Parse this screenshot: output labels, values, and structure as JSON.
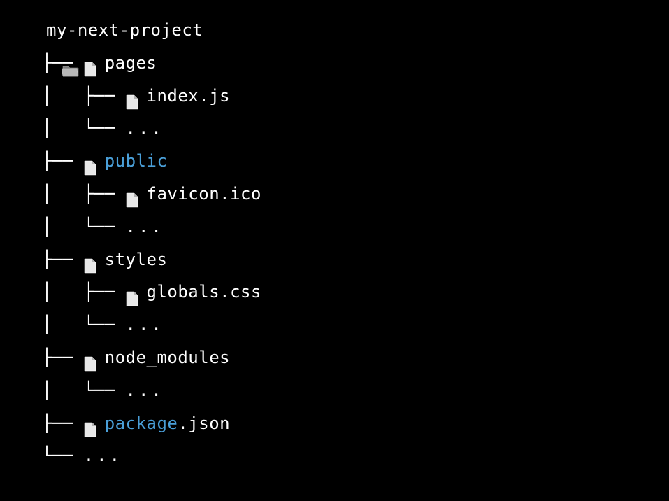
{
  "tree": {
    "root": {
      "name": "my-next-project",
      "type": "folder"
    },
    "lines": [
      {
        "prefix": "├── ",
        "icon": "file",
        "label": "pages",
        "highlight": false
      },
      {
        "prefix": "│   ├── ",
        "icon": "file",
        "label": "index.js",
        "highlight": false
      },
      {
        "prefix": "│   └── ",
        "icon": null,
        "label": "...",
        "ellipsis": true
      },
      {
        "prefix": "├── ",
        "icon": "file",
        "label": "public",
        "highlight": true
      },
      {
        "prefix": "│   ├── ",
        "icon": "file",
        "label": "favicon.ico",
        "highlight": false
      },
      {
        "prefix": "│   └── ",
        "icon": null,
        "label": "...",
        "ellipsis": true
      },
      {
        "prefix": "├── ",
        "icon": "file",
        "label": "styles",
        "highlight": false
      },
      {
        "prefix": "│   ├── ",
        "icon": "file",
        "label": "globals.css",
        "highlight": false
      },
      {
        "prefix": "│   └── ",
        "icon": null,
        "label": "...",
        "ellipsis": true
      },
      {
        "prefix": "├── ",
        "icon": "file",
        "label": "node_modules",
        "highlight": false
      },
      {
        "prefix": "│   └── ",
        "icon": null,
        "label": "...",
        "ellipsis": true
      },
      {
        "prefix": "├── ",
        "icon": "file",
        "label_parts": [
          {
            "text": "package",
            "highlight": true
          },
          {
            "text": ".json",
            "highlight": false
          }
        ]
      },
      {
        "prefix": "└── ",
        "icon": null,
        "label": "...",
        "ellipsis": true
      }
    ]
  }
}
